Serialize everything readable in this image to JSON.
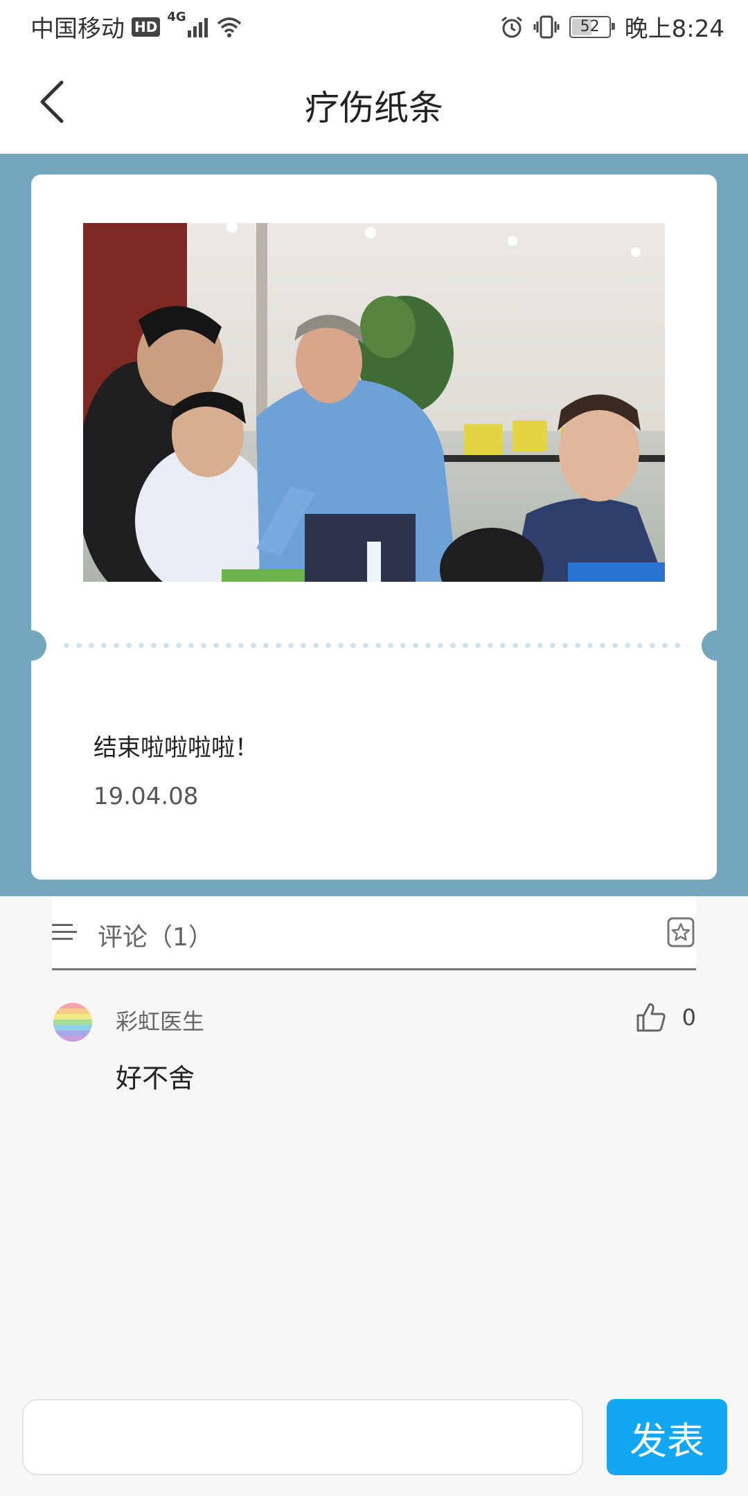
{
  "status_bar": {
    "carrier": "中国移动",
    "hd": "HD",
    "network": "4G",
    "battery": "52",
    "time": "晚上8:24",
    "icons": [
      "signal-icon",
      "wifi-icon",
      "alarm-icon",
      "vibrate-icon",
      "battery-icon"
    ]
  },
  "header": {
    "title": "疗伤纸条",
    "back_icon": "chevron-left-icon"
  },
  "note": {
    "image_alt": "photo",
    "text": "结束啦啦啦啦！",
    "date": "19.04.08"
  },
  "comments": {
    "title": "评论（1）",
    "menu_icon": "menu-icon",
    "star_icon": "star-icon",
    "items": [
      {
        "author": "彩虹医生",
        "text": "好不舍",
        "likes": "0",
        "avatar_colors": [
          "#f4a3a8",
          "#f7c98a",
          "#f3eb85",
          "#a8dc92",
          "#8fd0e6",
          "#a8a8e8",
          "#c9a0dc"
        ]
      }
    ]
  },
  "input": {
    "placeholder": "",
    "value": "",
    "send_label": "发表"
  },
  "colors": {
    "hero_bg": "#74a6bf",
    "send_button": "#13a6f2"
  }
}
